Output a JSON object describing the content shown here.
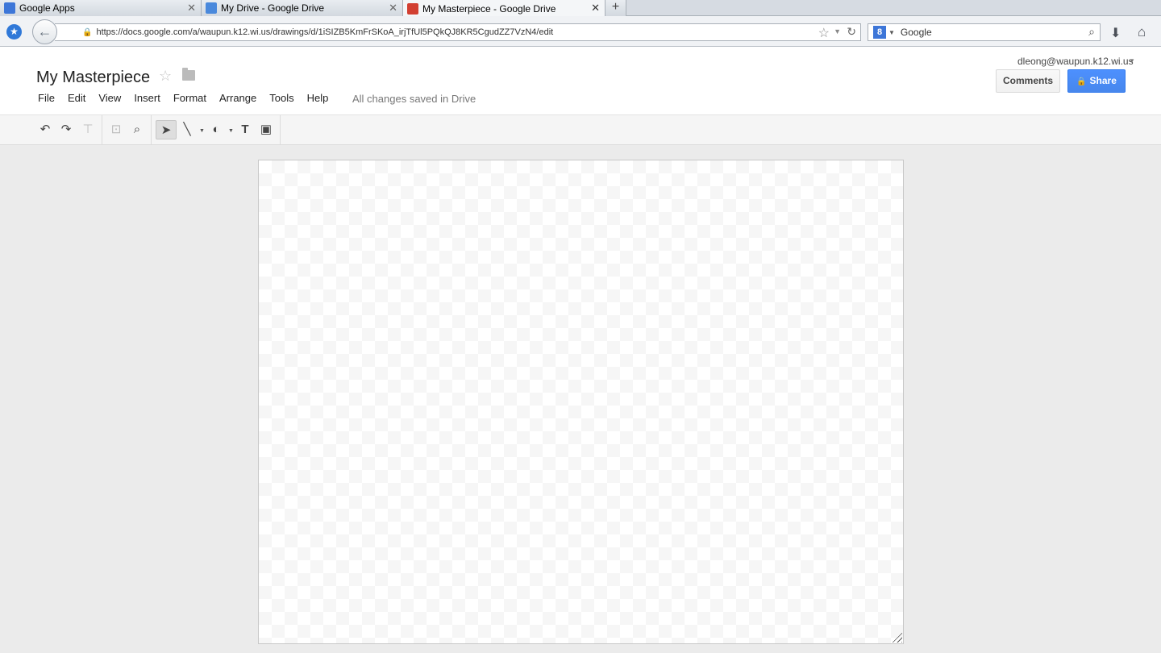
{
  "browser": {
    "tabs": [
      {
        "title": "Google Apps",
        "favicon_color": "#3d76d8"
      },
      {
        "title": "My Drive - Google Drive",
        "favicon_color": "#4a89dc"
      },
      {
        "title": "My Masterpiece - Google Drive",
        "favicon_color": "#d23f31",
        "active": true
      }
    ],
    "new_tab_label": "+",
    "url": "https://docs.google.com/a/waupun.k12.wi.us/drawings/d/1iSIZB5KmFrSKoA_irjTfUl5PQkQJ8KR5CgudZZ7VzN4/edit",
    "search_engine_letter": "8",
    "search_placeholder": "Google"
  },
  "app": {
    "document_title": "My Masterpiece",
    "user_email": "dleong@waupun.k12.wi.us",
    "comments_label": "Comments",
    "share_label": "Share",
    "menu": [
      "File",
      "Edit",
      "View",
      "Insert",
      "Format",
      "Arrange",
      "Tools",
      "Help"
    ],
    "save_status": "All changes saved in Drive",
    "accent_color": "#4d90fe"
  },
  "toolbar": {
    "tools": [
      {
        "name": "undo-icon",
        "glyph": "↶"
      },
      {
        "name": "redo-icon",
        "glyph": "↷"
      },
      {
        "name": "paint-format-icon",
        "glyph": "🖌"
      },
      {
        "name": "zoom-fit-icon",
        "glyph": "⊡"
      },
      {
        "name": "zoom-icon",
        "glyph": "🔍"
      },
      {
        "name": "select-arrow-icon",
        "glyph": "➤"
      },
      {
        "name": "line-icon",
        "glyph": "╲"
      },
      {
        "name": "shape-icon",
        "glyph": "◐"
      },
      {
        "name": "text-box-icon",
        "glyph": "T"
      },
      {
        "name": "image-icon",
        "glyph": "▣"
      }
    ]
  }
}
